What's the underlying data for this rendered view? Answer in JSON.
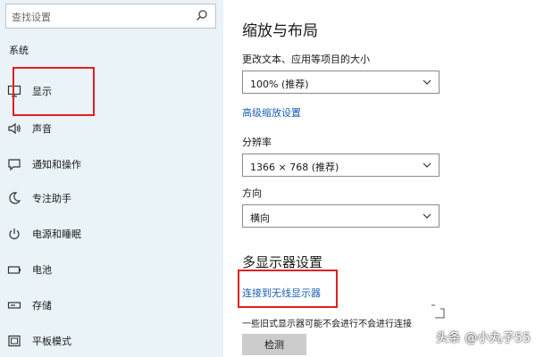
{
  "sidebar": {
    "search_placeholder": "查找设置",
    "section_title": "系统",
    "items": [
      {
        "label": "显示",
        "icon": "monitor-icon"
      },
      {
        "label": "声音",
        "icon": "speaker-icon"
      },
      {
        "label": "通知和操作",
        "icon": "notification-icon"
      },
      {
        "label": "专注助手",
        "icon": "moon-icon"
      },
      {
        "label": "电源和睡眠",
        "icon": "power-icon"
      },
      {
        "label": "电池",
        "icon": "battery-icon"
      },
      {
        "label": "存储",
        "icon": "storage-icon"
      },
      {
        "label": "平板模式",
        "icon": "tablet-icon"
      }
    ]
  },
  "main": {
    "title": "缩放与布局",
    "scale_label": "更改文本、应用等项目的大小",
    "scale_value": "100% (推荐)",
    "advanced_scale_link": "高级缩放设置",
    "resolution_label": "分辨率",
    "resolution_value": "1366 × 768 (推荐)",
    "orientation_label": "方向",
    "orientation_value": "横向",
    "multi_display_title": "多显示器设置",
    "wireless_link": "连接到无线显示器",
    "description": "一些旧式显示器可能不会进行不会进行连接",
    "detect_label": "检测"
  },
  "watermark": "头条 @小丸子55",
  "colors": {
    "sidebar_bg": "#eaf3f7",
    "highlight": "#e02020",
    "link": "#1a5fb4",
    "button_bg": "#cccccc"
  }
}
